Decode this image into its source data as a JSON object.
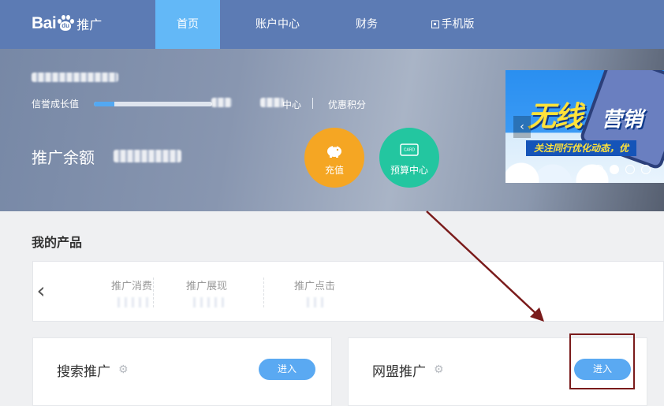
{
  "nav": {
    "logo_text": "Bai",
    "logo_du": "du",
    "logo_suffix": "推广",
    "items": [
      {
        "label": "首页",
        "active": true
      },
      {
        "label": "账户中心",
        "active": false
      },
      {
        "label": "财务",
        "active": false
      },
      {
        "label": "手机版",
        "active": false
      }
    ],
    "active_color": "#63b8f7",
    "bar_color": "#5c7bb4"
  },
  "hero": {
    "credit_label": "信誉成长值",
    "credit_progress": 0.17,
    "center_label": "中心",
    "points_label": "优惠积分",
    "balance_label": "推广余额",
    "recharge_label": "充值",
    "budget_label": "预算中心",
    "budget_icon_text": "CARD",
    "banner": {
      "title_yellow": "无线",
      "title_white": "营销",
      "subtitle": "关注同行优化动态，优",
      "prev_icon": "‹"
    }
  },
  "products": {
    "section_title": "我的产品",
    "stats": [
      {
        "name": "推广消费"
      },
      {
        "name": "推广展现"
      },
      {
        "name": "推广点击"
      }
    ],
    "cards": [
      {
        "title": "搜索推广",
        "button": "进入"
      },
      {
        "title": "网盟推广",
        "button": "进入"
      }
    ]
  }
}
